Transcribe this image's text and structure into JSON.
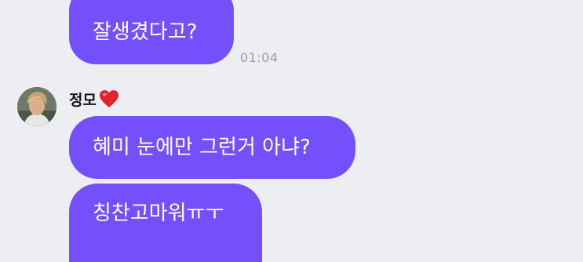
{
  "messages": [
    {
      "text": "잘생겼다고?",
      "time": "01:04",
      "outgoing": true
    },
    {
      "text": "혜미 눈에만 그런거 아냐?",
      "outgoing": false
    },
    {
      "text": "칭찬고마워ㅠㅜ",
      "outgoing": false
    }
  ],
  "sender": {
    "name": "정모",
    "avatar_icon": "profile-photo",
    "name_suffix_icon": "red-heart-icon"
  },
  "colors": {
    "background": "#edeef2",
    "bubble": "#7350fc",
    "bubble_text": "#ffffff",
    "timestamp": "#9a9ca2",
    "heart": "#e0252f"
  }
}
